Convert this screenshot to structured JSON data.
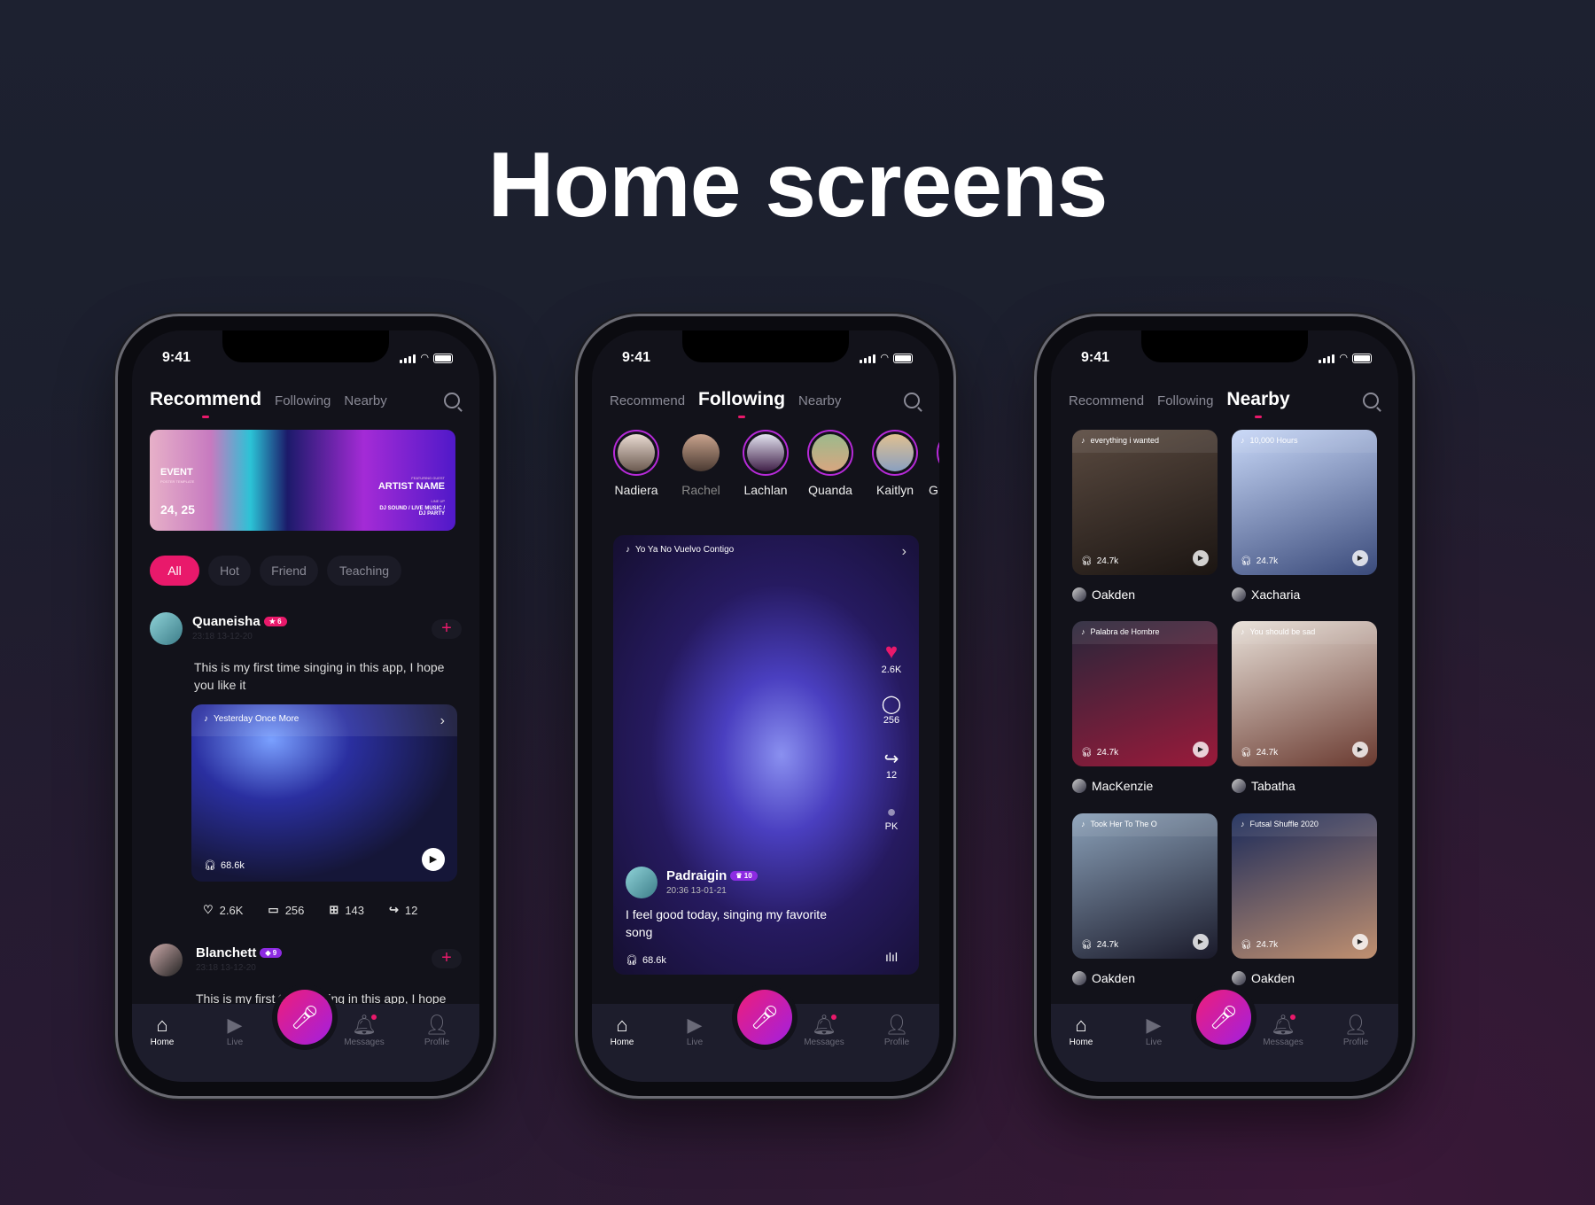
{
  "title": "Home screens",
  "colors": {
    "accent": "#e9196b",
    "purple": "#8d2be2",
    "background": "#1c1f2e"
  },
  "status": {
    "time": "9:41"
  },
  "tabs": [
    "Recommend",
    "Following",
    "Nearby"
  ],
  "nav": [
    {
      "label": "Home",
      "icon": "home-icon"
    },
    {
      "label": "Live",
      "icon": "video-icon"
    },
    {
      "label": "Messages",
      "icon": "bell-icon"
    },
    {
      "label": "Profile",
      "icon": "user-icon"
    }
  ],
  "recommend": {
    "banner": {
      "event": "EVENT",
      "subtitle": "POSTER TEMPLATE",
      "date": "24, 25",
      "guest_label": "FEATURING GUEST",
      "artist": "ARTIST NAME",
      "lineup_label": "LINE UP",
      "lineup": "DJ SOUND / LIVE MUSIC / DJ PARTY"
    },
    "chips": [
      "All",
      "Hot",
      "Friend",
      "Teaching"
    ],
    "posts": [
      {
        "user": "Quaneisha",
        "level": "6",
        "time": "23:18 13-12-20",
        "text": "This is my first time singing in this app, I hope you like it",
        "song": "Yesterday Once More",
        "listens": "68.6k",
        "likes": "2.6K",
        "comments": "256",
        "gifts": "143",
        "shares": "12"
      },
      {
        "user": "Blanchett",
        "level": "9",
        "time": "23:18 13-12-20",
        "text": "This is my first time singing in this app, I hope"
      }
    ]
  },
  "following": {
    "stories": [
      "Nadiera",
      "Rachel",
      "Lachlan",
      "Quanda",
      "Kaitlyn",
      "G"
    ],
    "post": {
      "song": "Yo Ya No Vuelvo Contigo",
      "user": "Padraigin",
      "level": "10",
      "time": "20:36 13-01-21",
      "text": "I feel good today, singing my favorite song",
      "listens": "68.6k",
      "likes": "2.6K",
      "comments": "256",
      "shares": "12",
      "pk": "PK"
    }
  },
  "nearby": {
    "cards": [
      {
        "song": "everything i wanted",
        "listens": "24.7k",
        "user": "Oakden"
      },
      {
        "song": "10,000 Hours",
        "listens": "24.7k",
        "user": "Xacharia"
      },
      {
        "song": "Palabra de Hombre",
        "listens": "24.7k",
        "user": "MacKenzie"
      },
      {
        "song": "You should be sad",
        "listens": "24.7k",
        "user": "Tabatha"
      },
      {
        "song": "Took Her To The O",
        "listens": "24.7k",
        "user": "Oakden"
      },
      {
        "song": "Futsal Shuffle 2020",
        "listens": "24.7k",
        "user": "Oakden"
      }
    ]
  }
}
